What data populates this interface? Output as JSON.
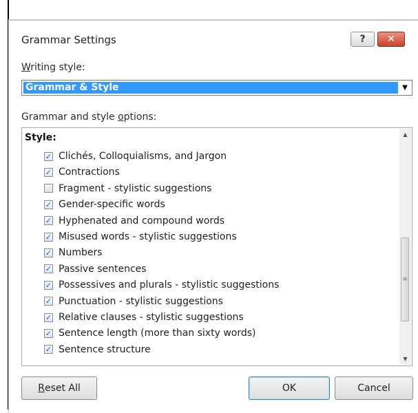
{
  "dialog": {
    "title": "Grammar Settings",
    "help_glyph": "?",
    "close_glyph": "✕"
  },
  "writing_style": {
    "label_accel": "W",
    "label_rest": "riting style:",
    "selected": "Grammar & Style",
    "dropdown_glyph": "▼"
  },
  "options": {
    "label_pre": "Grammar and style ",
    "label_accel": "o",
    "label_post": "ptions:",
    "group_label": "Style:",
    "items": [
      {
        "label": "Clichés, Colloquialisms, and Jargon",
        "checked": true
      },
      {
        "label": "Contractions",
        "checked": true
      },
      {
        "label": "Fragment - stylistic suggestions",
        "checked": false
      },
      {
        "label": "Gender-specific words",
        "checked": true
      },
      {
        "label": "Hyphenated and compound words",
        "checked": true
      },
      {
        "label": "Misused words - stylistic suggestions",
        "checked": true
      },
      {
        "label": "Numbers",
        "checked": true
      },
      {
        "label": "Passive sentences",
        "checked": true
      },
      {
        "label": "Possessives and plurals - stylistic suggestions",
        "checked": true
      },
      {
        "label": "Punctuation - stylistic suggestions",
        "checked": true
      },
      {
        "label": "Relative clauses - stylistic suggestions",
        "checked": true
      },
      {
        "label": "Sentence length (more than sixty words)",
        "checked": true
      },
      {
        "label": "Sentence structure",
        "checked": true
      },
      {
        "label": "",
        "checked": true
      }
    ]
  },
  "scrollbar": {
    "up_glyph": "▲",
    "down_glyph": "▼",
    "grip_glyph": "≡"
  },
  "buttons": {
    "reset_accel": "R",
    "reset_rest": "eset All",
    "ok": "OK",
    "cancel": "Cancel"
  },
  "colors": {
    "selection": "#3399ff",
    "close_button": "#c8432a",
    "checkmark": "#2b62c9"
  }
}
